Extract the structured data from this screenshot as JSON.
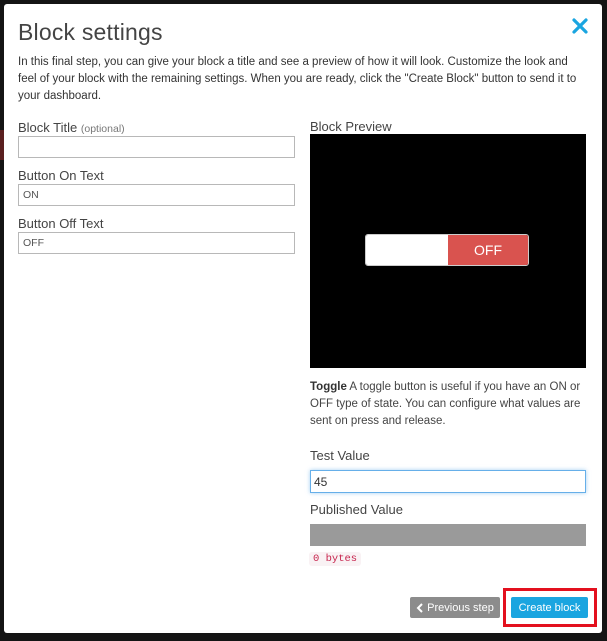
{
  "modal": {
    "title": "Block settings",
    "intro": "In this final step, you can give your block a title and see a preview of how it will look. Customize the look and feel of your block with the remaining settings. When you are ready, click the \"Create Block\" button to send it to your dashboard."
  },
  "form": {
    "block_title_label": "Block Title",
    "block_title_optional": "(optional)",
    "block_title_value": "",
    "on_text_label": "Button On Text",
    "on_text_value": "ON",
    "off_text_label": "Button Off Text",
    "off_text_value": "OFF"
  },
  "preview": {
    "label": "Block Preview",
    "toggle_state_text": "OFF",
    "toggle_off_color": "#d9534f"
  },
  "description": {
    "type_name": "Toggle",
    "text": " A toggle button is useful if you have an ON or OFF type of state. You can configure what values are sent on press and release."
  },
  "test": {
    "label": "Test Value",
    "value": "45"
  },
  "published": {
    "label": "Published Value",
    "bytes": "0 bytes"
  },
  "buttons": {
    "previous_label": "Previous step",
    "create_label": "Create block",
    "create_color": "#1aa5e0",
    "highlight_color": "#e3101e"
  },
  "icons": {
    "close": "close-icon",
    "previous": "chevron-left-icon"
  }
}
